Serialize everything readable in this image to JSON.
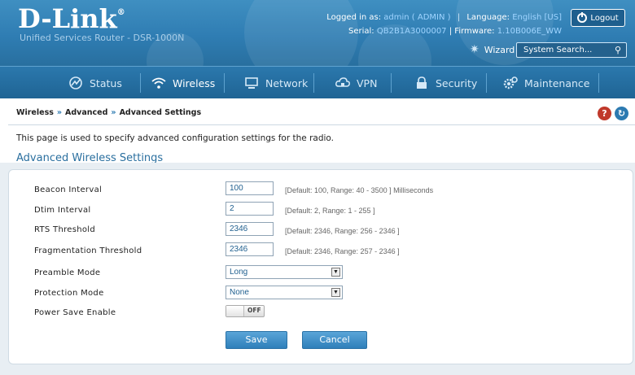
{
  "header": {
    "brand": "D-Link",
    "brand_mark": "®",
    "subtitle": "Unified Services Router - DSR-1000N",
    "logged_in_label": "Logged in as:",
    "logged_in_value": "admin ( ADMIN )",
    "language_label": "Language:",
    "language_value": "English [US]",
    "serial_label": "Serial:",
    "serial_value": "QB2B1A3000007",
    "firmware_label": "Firmware:",
    "firmware_value": "1.10B006E_WW",
    "logout_label": "Logout",
    "wizard_label": "Wizard",
    "search_placeholder": "System Search..."
  },
  "nav": {
    "items": [
      {
        "label": "Status",
        "icon": "status-icon"
      },
      {
        "label": "Wireless",
        "icon": "wireless-icon"
      },
      {
        "label": "Network",
        "icon": "network-icon"
      },
      {
        "label": "VPN",
        "icon": "vpn-icon"
      },
      {
        "label": "Security",
        "icon": "lock-icon"
      },
      {
        "label": "Maintenance",
        "icon": "gear-icon"
      }
    ],
    "active": "Wireless"
  },
  "breadcrumb": {
    "items": [
      "Wireless",
      "Advanced",
      "Advanced Settings"
    ],
    "separator": "»"
  },
  "page": {
    "description": "This page is used to specify advanced configuration settings for the radio.",
    "section_title": "Advanced Wireless Settings"
  },
  "form": {
    "beacon": {
      "label": "Beacon Interval",
      "value": "100",
      "hint": "[Default: 100, Range: 40 - 3500 ] Milliseconds"
    },
    "dtim": {
      "label": "Dtim Interval",
      "value": "2",
      "hint": "[Default: 2, Range: 1 - 255 ]"
    },
    "rts": {
      "label": "RTS Threshold",
      "value": "2346",
      "hint": "[Default: 2346, Range: 256 - 2346 ]"
    },
    "frag": {
      "label": "Fragmentation Threshold",
      "value": "2346",
      "hint": "[Default: 2346, Range: 257 - 2346 ]"
    },
    "preamble": {
      "label": "Preamble Mode",
      "value": "Long"
    },
    "protection": {
      "label": "Protection Mode",
      "value": "None"
    },
    "powersave": {
      "label": "Power Save Enable",
      "state": "OFF"
    },
    "save_label": "Save",
    "cancel_label": "Cancel"
  },
  "colors": {
    "header": "#2f7db3",
    "accent": "#2c7ab1",
    "help_icon": "#c0392b",
    "refresh_icon": "#2c7ab1"
  }
}
